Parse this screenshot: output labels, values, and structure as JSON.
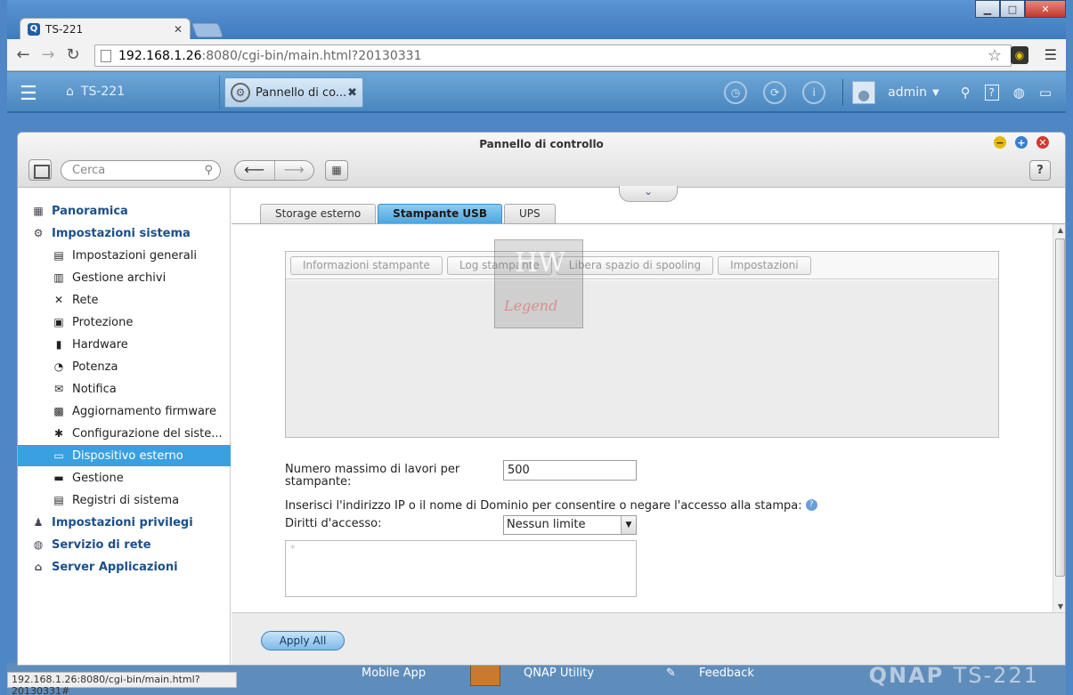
{
  "browser": {
    "tab_title": "TS-221",
    "url_host": "192.168.1.26",
    "url_rest": ":8080/cgi-bin/main.html?20130331",
    "status_url": "192.168.1.26:8080/cgi-bin/main.html?20130331#"
  },
  "qnap_bar": {
    "device_name": "TS-221",
    "open_app": "Pannello di co...",
    "user": "admin"
  },
  "desktop": {
    "items": [
      "Mobile App",
      "QNAP Utility",
      "Feedback"
    ],
    "logo": "QNAP",
    "model": "TS-221"
  },
  "window": {
    "title": "Pannello di controllo",
    "search_placeholder": "Cerca"
  },
  "sidebar": {
    "items": [
      {
        "label": "Panoramica",
        "level": "top",
        "icon": "overview-icon"
      },
      {
        "label": "Impostazioni sistema",
        "level": "top",
        "icon": "gear-icon"
      },
      {
        "label": "Impostazioni generali",
        "level": "sub",
        "icon": "settings-icon"
      },
      {
        "label": "Gestione archivi",
        "level": "sub",
        "icon": "storage-icon"
      },
      {
        "label": "Rete",
        "level": "sub",
        "icon": "network-icon"
      },
      {
        "label": "Protezione",
        "level": "sub",
        "icon": "lock-icon"
      },
      {
        "label": "Hardware",
        "level": "sub",
        "icon": "hardware-icon"
      },
      {
        "label": "Potenza",
        "level": "sub",
        "icon": "bulb-icon"
      },
      {
        "label": "Notifica",
        "level": "sub",
        "icon": "notification-icon"
      },
      {
        "label": "Aggiornamento firmware",
        "level": "sub",
        "icon": "firmware-icon"
      },
      {
        "label": "Configurazione del siste...",
        "level": "sub",
        "icon": "config-icon"
      },
      {
        "label": "Dispositivo esterno",
        "level": "sub",
        "icon": "external-device-icon",
        "active": true
      },
      {
        "label": "Gestione",
        "level": "sub",
        "icon": "monitor-icon"
      },
      {
        "label": "Registri di sistema",
        "level": "sub",
        "icon": "log-icon"
      },
      {
        "label": "Impostazioni privilegi",
        "level": "top",
        "icon": "user-icon"
      },
      {
        "label": "Servizio di rete",
        "level": "top",
        "icon": "globe-icon"
      },
      {
        "label": "Server Applicazioni",
        "level": "top",
        "icon": "server-icon"
      }
    ]
  },
  "tabs": [
    "Storage esterno",
    "Stampante USB",
    "UPS"
  ],
  "active_tab": "Stampante USB",
  "printer_toolbar": [
    "Informazioni stampante",
    "Log stampante",
    "Libera spazio di spooling",
    "Impostazioni"
  ],
  "watermark": {
    "top": "HW",
    "bottom": "Legend"
  },
  "form": {
    "max_jobs_label_1": "Numero massimo di lavori per",
    "max_jobs_label_2": "stampante:",
    "max_jobs_value": "500",
    "ip_instruction": "Inserisci l'indirizzo IP o il nome di Dominio per consentire o negare l'accesso alla stampa:",
    "access_label": "Diritti d'accesso:",
    "access_value": "Nessun limite",
    "textarea_placeholder": "*"
  },
  "apply_label": "Apply All"
}
